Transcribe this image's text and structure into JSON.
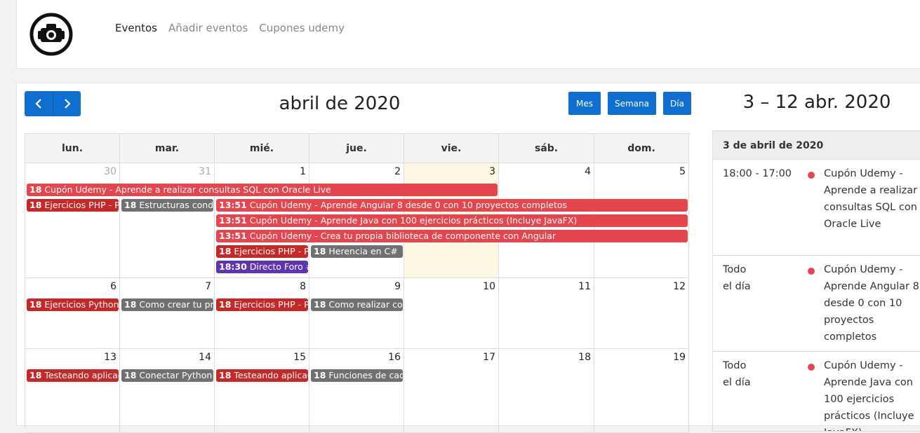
{
  "nav": {
    "links": [
      "Eventos",
      "Añadir eventos",
      "Cupones udemy"
    ]
  },
  "calendar": {
    "title": "abril de 2020",
    "views": [
      "Mes",
      "Semana",
      "Día"
    ],
    "weekdays": [
      "lun.",
      "mar.",
      "mié.",
      "jue.",
      "vie.",
      "sáb.",
      "dom."
    ],
    "weeks": [
      [
        {
          "n": "30",
          "other": true
        },
        {
          "n": "31",
          "other": true
        },
        {
          "n": "1"
        },
        {
          "n": "2"
        },
        {
          "n": "3",
          "today": true
        },
        {
          "n": "4"
        },
        {
          "n": "5"
        }
      ],
      [
        {
          "n": "6"
        },
        {
          "n": "7"
        },
        {
          "n": "8"
        },
        {
          "n": "9"
        },
        {
          "n": "10"
        },
        {
          "n": "11"
        },
        {
          "n": "12"
        }
      ],
      [
        {
          "n": "13"
        },
        {
          "n": "14"
        },
        {
          "n": "15"
        },
        {
          "n": "16"
        },
        {
          "n": "17"
        },
        {
          "n": "18"
        },
        {
          "n": "19"
        }
      ]
    ],
    "events": [
      {
        "week": 0,
        "start": 0,
        "span": 5,
        "row": 0,
        "time": "18",
        "title": "Cupón Udemy - Aprende a realizar consultas SQL con Oracle Live",
        "color": "#e5454c"
      },
      {
        "week": 0,
        "start": 0,
        "span": 1,
        "row": 1,
        "time": "18",
        "title": "Ejercicios PHP - P",
        "color": "#c62828"
      },
      {
        "week": 0,
        "start": 1,
        "span": 1,
        "row": 1,
        "time": "18",
        "title": "Estructuras condi",
        "color": "#707070"
      },
      {
        "week": 0,
        "start": 2,
        "span": 5,
        "row": 1,
        "time": "13:51",
        "title": "Cupón Udemy - Aprende Angular 8 desde 0 con 10 proyectos completos",
        "color": "#e5454c"
      },
      {
        "week": 0,
        "start": 2,
        "span": 5,
        "row": 2,
        "time": "13:51",
        "title": "Cupón Udemy - Aprende Java con 100 ejercicios prácticos (Incluye JavaFX)",
        "color": "#e5454c"
      },
      {
        "week": 0,
        "start": 2,
        "span": 5,
        "row": 3,
        "time": "13:51",
        "title": "Cupón Udemy - Crea tu propia biblioteca de componente con Angular",
        "color": "#e5454c"
      },
      {
        "week": 0,
        "start": 2,
        "span": 1,
        "row": 4,
        "time": "18",
        "title": "Ejercicios PHP - P",
        "color": "#c62828"
      },
      {
        "week": 0,
        "start": 3,
        "span": 1,
        "row": 4,
        "time": "18",
        "title": "Herencia en C#",
        "color": "#707070"
      },
      {
        "week": 0,
        "start": 2,
        "span": 1,
        "row": 5,
        "time": "18:30",
        "title": "Directo Foro #",
        "color": "#5e35b1"
      },
      {
        "week": 1,
        "start": 0,
        "span": 1,
        "row": 0,
        "time": "18",
        "title": "Ejercicios Python",
        "color": "#c62828"
      },
      {
        "week": 1,
        "start": 1,
        "span": 1,
        "row": 0,
        "time": "18",
        "title": "Como crear tu pr",
        "color": "#707070"
      },
      {
        "week": 1,
        "start": 2,
        "span": 1,
        "row": 0,
        "time": "18",
        "title": "Ejercicios PHP - P",
        "color": "#c62828"
      },
      {
        "week": 1,
        "start": 3,
        "span": 1,
        "row": 0,
        "time": "18",
        "title": "Como realizar con",
        "color": "#707070"
      },
      {
        "week": 2,
        "start": 0,
        "span": 1,
        "row": 0,
        "time": "18",
        "title": "Testeando aplicac",
        "color": "#c62828"
      },
      {
        "week": 2,
        "start": 1,
        "span": 1,
        "row": 0,
        "time": "18",
        "title": "Conectar Python",
        "color": "#707070"
      },
      {
        "week": 2,
        "start": 2,
        "span": 1,
        "row": 0,
        "time": "18",
        "title": "Testeando aplicac",
        "color": "#c62828"
      },
      {
        "week": 2,
        "start": 3,
        "span": 1,
        "row": 0,
        "time": "18",
        "title": "Funciones de cad",
        "color": "#707070"
      }
    ]
  },
  "list": {
    "title": "3 – 12 abr. 2020",
    "day_header": "3 de abril de 2020",
    "items": [
      {
        "time": "18:00 - 17:00",
        "title": "Cupón Udemy - Aprende a realizar consultas SQL con Oracle Live"
      },
      {
        "time": "Todo el día",
        "title": "Cupón Udemy - Aprende Angular 8 desde 0 con 10 proyectos completos"
      },
      {
        "time": "Todo el día",
        "title": "Cupón Udemy - Aprende Java con 100 ejercicios prácticos (Incluye JavaFX)"
      }
    ]
  }
}
